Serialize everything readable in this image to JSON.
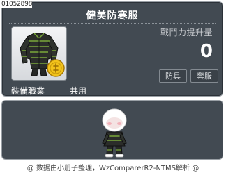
{
  "item": {
    "id": "01052898",
    "name": "健美防寒服",
    "power_label": "戰鬥力提升量",
    "power_value": "0",
    "types": [
      "防具",
      "套服"
    ],
    "job_label": "裝備職業",
    "job_value": "共用",
    "icon": "winter-coat-icon",
    "badge_icon": "gold-coin-icon",
    "avatar": "character-preview-avatar"
  },
  "colors": {
    "panel": "#424a52",
    "panel_border": "#9aa0a6",
    "title": "#ffffff",
    "label": "#c9ccd0"
  },
  "footer": {
    "text": "@ 数据由小册子整理，WzComparerR2-NTMS解析 @"
  }
}
